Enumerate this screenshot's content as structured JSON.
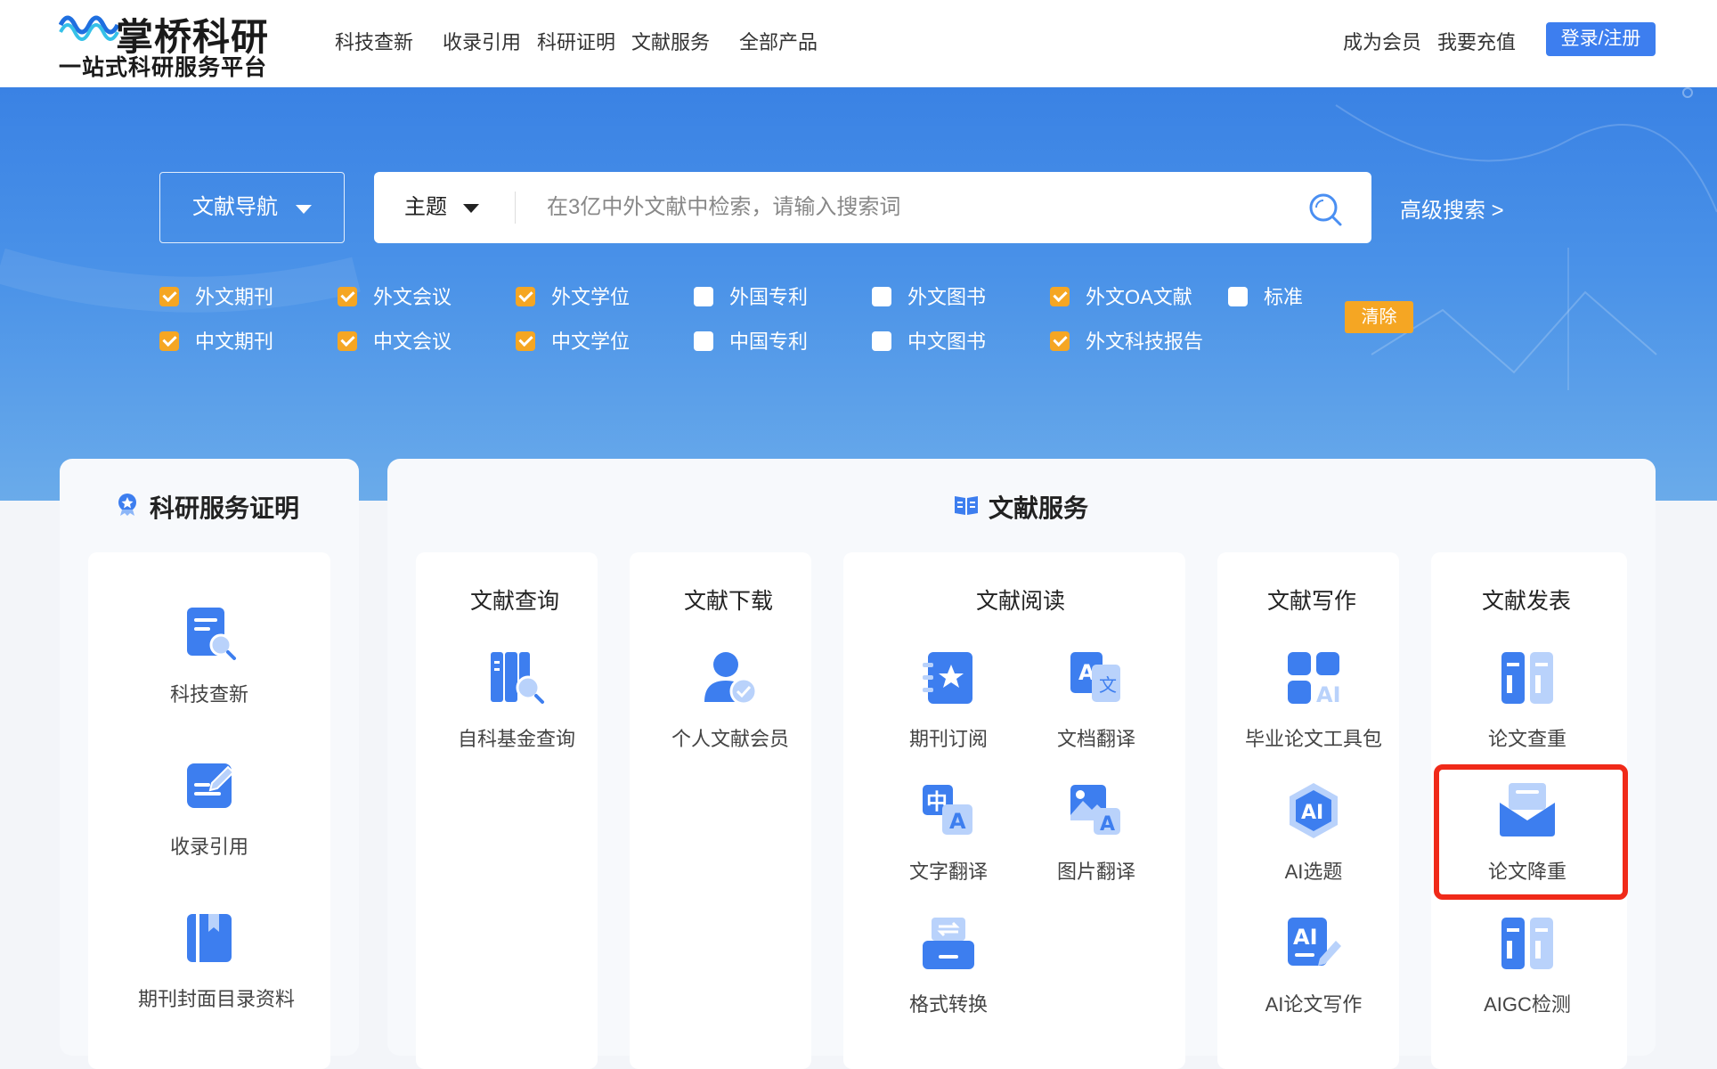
{
  "header": {
    "logo_title": "掌桥科研",
    "logo_subtitle": "一站式科研服务平台",
    "nav_items": [
      "科技查新",
      "收录引用",
      "科研证明",
      "文献服务",
      "全部产品"
    ],
    "member": "成为会员",
    "recharge": "我要充值",
    "login": "登录/注册"
  },
  "search": {
    "nav_select": "文献导航",
    "field": "主题",
    "placeholder": "在3亿中外文献中检索，请输入搜索词",
    "advanced": "高级搜索 >",
    "clear": "清除",
    "checkboxes": [
      {
        "label": "外文期刊",
        "checked": true
      },
      {
        "label": "外文会议",
        "checked": true
      },
      {
        "label": "外文学位",
        "checked": true
      },
      {
        "label": "外国专利",
        "checked": false
      },
      {
        "label": "外文图书",
        "checked": false
      },
      {
        "label": "外文OA文献",
        "checked": true
      },
      {
        "label": "标准",
        "checked": false
      },
      {
        "label": "中文期刊",
        "checked": true
      },
      {
        "label": "中文会议",
        "checked": true
      },
      {
        "label": "中文学位",
        "checked": true
      },
      {
        "label": "中国专利",
        "checked": false
      },
      {
        "label": "中文图书",
        "checked": false
      },
      {
        "label": "外文科技报告",
        "checked": true
      }
    ]
  },
  "left_card": {
    "title": "科研服务证明",
    "items": [
      "科技查新",
      "收录引用",
      "期刊封面目录资料"
    ]
  },
  "right_card": {
    "title": "文献服务",
    "columns": [
      {
        "title": "文献查询",
        "items": [
          "自科基金查询"
        ]
      },
      {
        "title": "文献下载",
        "items": [
          "个人文献会员"
        ]
      },
      {
        "title": "文献阅读",
        "items": [
          "期刊订阅",
          "文档翻译",
          "文字翻译",
          "图片翻译",
          "格式转换"
        ]
      },
      {
        "title": "文献写作",
        "items": [
          "毕业论文工具包",
          "AI选题",
          "AI论文写作"
        ]
      },
      {
        "title": "文献发表",
        "items": [
          "论文查重",
          "论文降重",
          "AIGC检测"
        ]
      }
    ]
  },
  "colors": {
    "accent": "#3d7eef",
    "checkbox_on": "#f5a623",
    "highlight": "#f02a19"
  }
}
